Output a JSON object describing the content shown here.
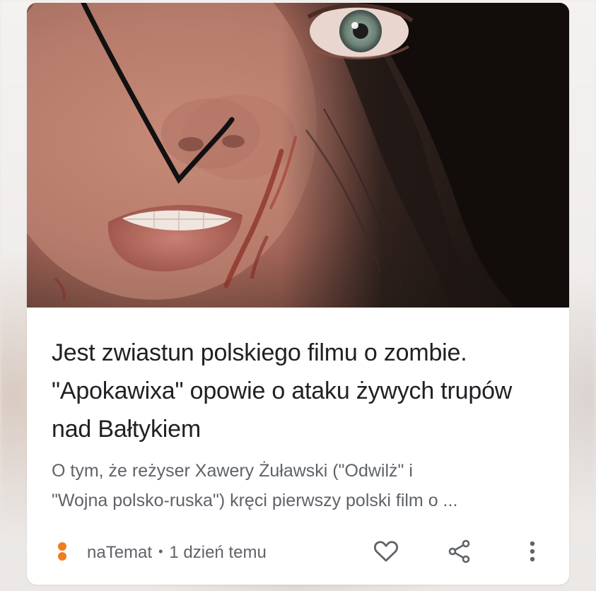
{
  "article": {
    "image_alt": "Close-up of a woman's face with a scratch on her cheek and dark hair",
    "title": "Jest zwiastun polskiego filmu o zombie. \"Apokawixa\" opowie o ataku żywych trupów nad Bałtykiem",
    "snippet": "O tym, że reżyser Xawery Żuławski (\"Odwilż\" i\n\"Wojna polsko-ruska\") kręci pierwszy polski film o ...",
    "source": "naTemat",
    "separator": "•",
    "time_ago": "1 dzień temu"
  },
  "icons": {
    "source_logo": "natemat-logo",
    "like": "heart-icon",
    "share": "share-icon",
    "more": "more-vert-icon"
  },
  "colors": {
    "source_logo": "#f07d1e",
    "title": "#202124",
    "secondary_text": "#5f6368",
    "icon": "#5f6368"
  }
}
